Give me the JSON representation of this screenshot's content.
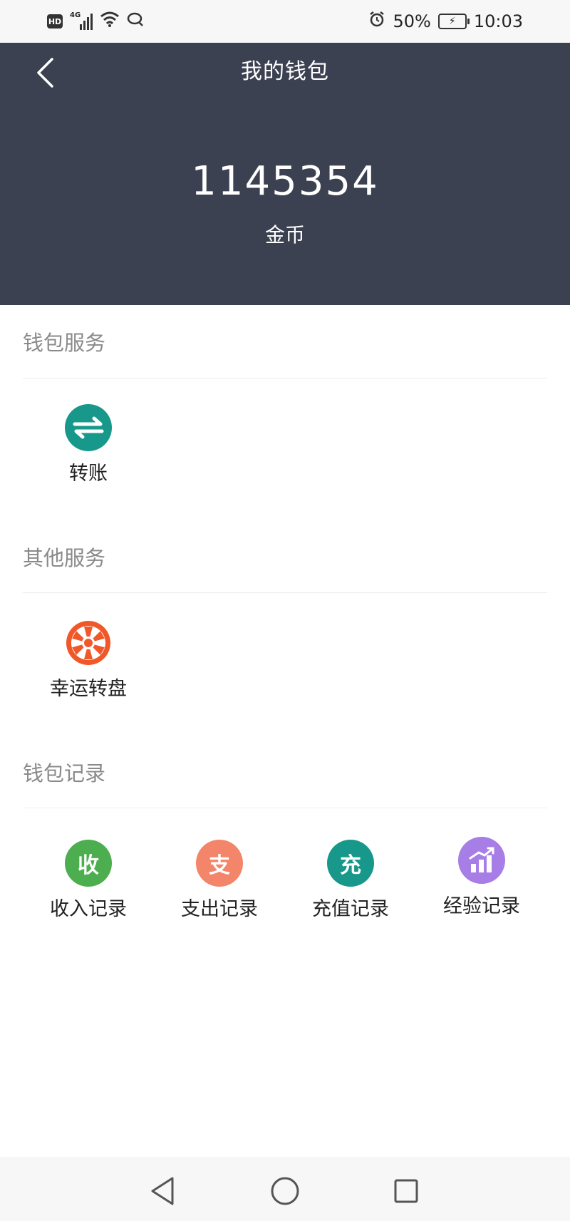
{
  "status_bar": {
    "hd": "HD",
    "network": "4G",
    "battery_percent": "50%",
    "time": "10:03"
  },
  "header": {
    "title": "我的钱包",
    "balance": "1145354",
    "balance_unit": "金币"
  },
  "sections": {
    "wallet_service": {
      "title": "钱包服务",
      "items": [
        {
          "label": "转账",
          "icon": "transfer-icon",
          "color": "#17988a"
        }
      ]
    },
    "other_service": {
      "title": "其他服务",
      "items": [
        {
          "label": "幸运转盘",
          "icon": "lucky-wheel-icon",
          "color": "#f0582a"
        }
      ]
    },
    "wallet_records": {
      "title": "钱包记录",
      "items": [
        {
          "label": "收入记录",
          "glyph": "收",
          "icon": "income-icon",
          "color": "#4cae4f"
        },
        {
          "label": "支出记录",
          "glyph": "支",
          "icon": "expense-icon",
          "color": "#f3866a"
        },
        {
          "label": "充值记录",
          "glyph": "充",
          "icon": "recharge-icon",
          "color": "#17988a"
        },
        {
          "label": "经验记录",
          "icon": "experience-chart-icon",
          "color": "#a77de6"
        }
      ]
    }
  },
  "colors": {
    "header_bg": "#3b4150",
    "section_title": "#8a8a8a"
  }
}
